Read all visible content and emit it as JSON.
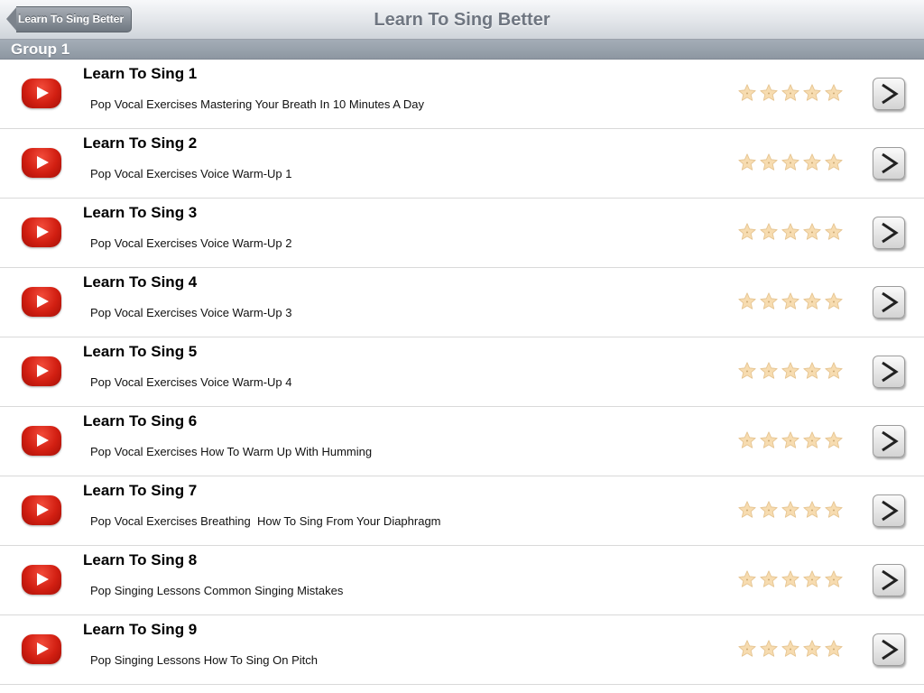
{
  "navbar": {
    "title": "Learn To Sing Better",
    "back_label": "Learn To Sing Better"
  },
  "section": {
    "header": "Group 1"
  },
  "colors": {
    "play_red": "#d21f12",
    "star_fill": "#f7dcb0",
    "navbar_title": "#6f7681"
  },
  "icons": {
    "play": "play-icon",
    "rating": "star-icon",
    "disclosure": "chevron-right-icon",
    "back": "back-arrow-icon"
  },
  "rows": [
    {
      "title": "Learn To Sing 1",
      "subtitle": "Pop Vocal Exercises Mastering Your Breath In 10 Minutes A Day",
      "rating": 5
    },
    {
      "title": "Learn To Sing 2",
      "subtitle": "Pop Vocal Exercises Voice Warm-Up 1",
      "rating": 5
    },
    {
      "title": "Learn To Sing 3",
      "subtitle": "Pop Vocal Exercises Voice Warm-Up 2",
      "rating": 5
    },
    {
      "title": "Learn To Sing 4",
      "subtitle": "Pop Vocal Exercises Voice Warm-Up 3",
      "rating": 5
    },
    {
      "title": "Learn To Sing 5",
      "subtitle": "Pop Vocal Exercises Voice Warm-Up 4",
      "rating": 5
    },
    {
      "title": "Learn To Sing 6",
      "subtitle": "Pop Vocal Exercises How To Warm Up With Humming",
      "rating": 5
    },
    {
      "title": "Learn To Sing 7",
      "subtitle": "Pop Vocal Exercises Breathing  How To Sing From Your Diaphragm",
      "rating": 5
    },
    {
      "title": "Learn To Sing 8",
      "subtitle": "Pop Singing Lessons Common Singing Mistakes",
      "rating": 5
    },
    {
      "title": "Learn To Sing 9",
      "subtitle": "Pop Singing Lessons How To Sing On Pitch",
      "rating": 5
    }
  ]
}
